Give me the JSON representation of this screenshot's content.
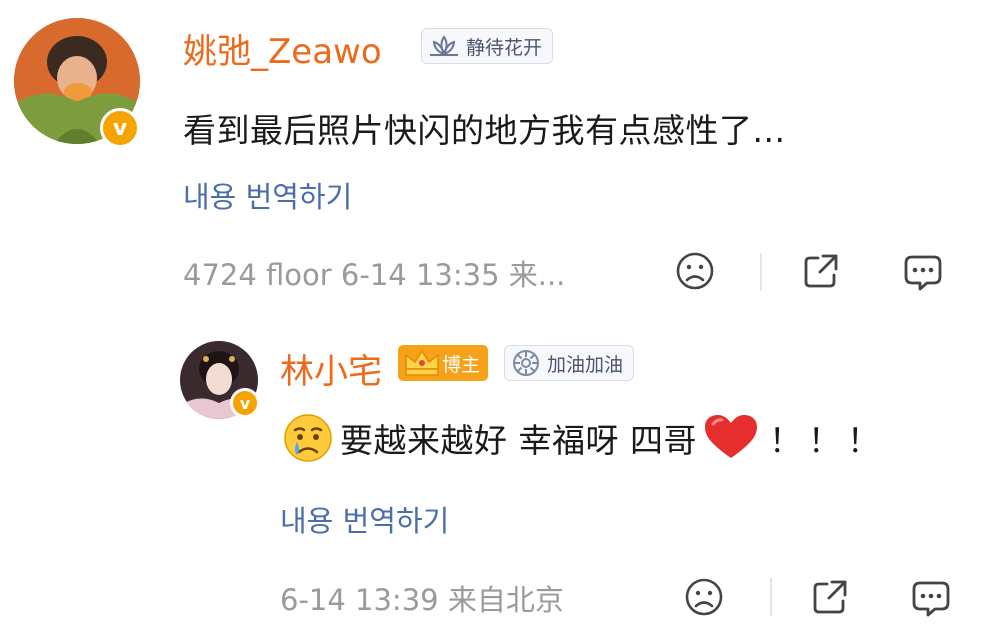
{
  "colors": {
    "username": "#ec6a1a",
    "translate": "#4a6ea8",
    "meta": "#9a9a9a",
    "badge": "#f5a300",
    "heart": "#e62e2e"
  },
  "comment": {
    "username": "姚弛_Zeawo",
    "tag": "静待花开",
    "text": "看到最后照片快闪的地方我有点感性了...",
    "translate": "내용 번역하기",
    "meta": "4724 floor 6-14 13:35 来...",
    "badge_letter": "v"
  },
  "reply": {
    "username": "林小宅",
    "role_badge": "博主",
    "tag": "加油加油",
    "text_main": "要越来越好 幸福呀 四哥",
    "text_end": "！！！",
    "translate": "내용 번역하기",
    "meta": "6-14 13:39 来自北京",
    "badge_letter": "v"
  },
  "icons": [
    "sad-face-icon",
    "share-icon",
    "comment-icon"
  ]
}
